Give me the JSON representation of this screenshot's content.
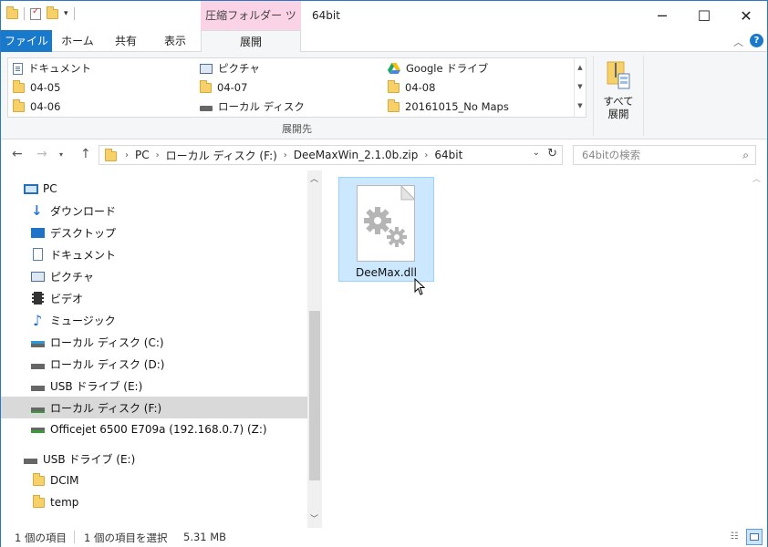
{
  "titlebar": {
    "context_tab": "圧縮フォルダー ツール",
    "title": "64bit",
    "minimize": "─",
    "maximize": "☐",
    "close": "✕"
  },
  "ribbon_tabs": {
    "file": "ファイル",
    "home": "ホーム",
    "share": "共有",
    "view": "表示",
    "extract": "展開"
  },
  "ribbon": {
    "gallery": [
      {
        "label": "ドキュメント",
        "icon": "document-icon"
      },
      {
        "label": "ピクチャ",
        "icon": "picture-icon"
      },
      {
        "label": "Google ドライブ",
        "icon": "google-drive-icon"
      },
      {
        "label": "04-05",
        "icon": "folder-icon"
      },
      {
        "label": "04-07",
        "icon": "folder-icon"
      },
      {
        "label": "04-08",
        "icon": "folder-icon"
      },
      {
        "label": "04-06",
        "icon": "folder-icon"
      },
      {
        "label": "ローカル ディスク",
        "icon": "drive-icon"
      },
      {
        "label": "20161015_No Maps",
        "icon": "folder-icon"
      }
    ],
    "group_label": "展開先",
    "extract_all": "すべて展開",
    "extract_all_line1": "すべて",
    "extract_all_line2": "展開"
  },
  "address": {
    "crumbs": [
      "PC",
      "ローカル ディスク (F:)",
      "DeeMaxWin_2.1.0b.zip",
      "64bit"
    ],
    "search_placeholder": "64bitの検索"
  },
  "nav_pane": {
    "items": [
      {
        "label": "PC",
        "icon": "pc-icon"
      },
      {
        "label": "ダウンロード",
        "icon": "download-icon"
      },
      {
        "label": "デスクトップ",
        "icon": "desktop-icon"
      },
      {
        "label": "ドキュメント",
        "icon": "document-icon"
      },
      {
        "label": "ピクチャ",
        "icon": "picture-icon"
      },
      {
        "label": "ビデオ",
        "icon": "video-icon"
      },
      {
        "label": "ミュージック",
        "icon": "music-icon"
      },
      {
        "label": "ローカル ディスク (C:)",
        "icon": "drive-icon"
      },
      {
        "label": "ローカル ディスク (D:)",
        "icon": "drive-icon"
      },
      {
        "label": "USB ドライブ (E:)",
        "icon": "usb-drive-icon"
      },
      {
        "label": "ローカル ディスク (F:)",
        "icon": "drive-icon",
        "selected": true
      },
      {
        "label": "Officejet 6500 E709a (192.168.0.7) (Z:)",
        "icon": "network-drive-icon"
      },
      {
        "label": "USB ドライブ (E:)",
        "icon": "usb-drive-icon"
      },
      {
        "label": "DCIM",
        "icon": "folder-icon"
      },
      {
        "label": "temp",
        "icon": "folder-icon"
      }
    ]
  },
  "content": {
    "files": [
      {
        "name": "DeeMax.dll",
        "icon": "dll-gear-icon",
        "selected": true
      }
    ]
  },
  "status": {
    "item_count": "1 個の項目",
    "selection": "1 個の項目を選択",
    "size": "5.31 MB"
  },
  "colors": {
    "accent": "#1979ca",
    "context_tab": "#fbd3e6",
    "selection": "#cce8ff",
    "folder": "#f6d16a"
  }
}
